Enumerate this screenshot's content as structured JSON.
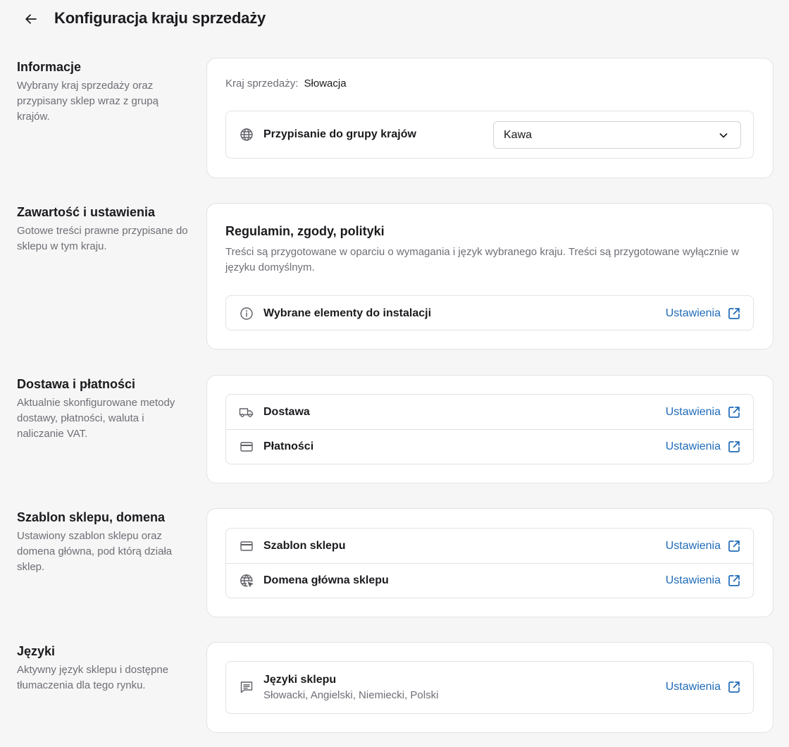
{
  "header": {
    "title": "Konfiguracja kraju sprzedaży"
  },
  "colors": {
    "link": "#1f6bb8",
    "muted": "#6e6e76",
    "border": "#e3e3e6"
  },
  "sections": {
    "info": {
      "title": "Informacje",
      "description": "Wybrany kraj sprzedaży oraz przypisany sklep wraz z grupą krajów.",
      "country_label": "Kraj sprzedaży:",
      "country_value": "Słowacja",
      "group_row": {
        "icon": "globe-icon",
        "label": "Przypisanie do grupy krajów",
        "selected": "Kawa"
      }
    },
    "content": {
      "title": "Zawartość i ustawienia",
      "description": "Gotowe treści prawne przypisane do sklepu w tym kraju.",
      "heading": "Regulamin, zgody, polityki",
      "text": "Treści są przygotowane w oparciu o wymagania i język wybranego kraju. Treści są przygotowane wyłącznie w języku domyślnym.",
      "row": {
        "icon": "info-icon",
        "label": "Wybrane elementy do instalacji",
        "link": "Ustawienia"
      }
    },
    "delivery": {
      "title": "Dostawa i płatności",
      "description": "Aktualnie skonfigurowane metody dostawy, płatności, waluta i naliczanie VAT.",
      "rows": [
        {
          "icon": "truck-icon",
          "label": "Dostawa",
          "link": "Ustawienia"
        },
        {
          "icon": "credit-card-icon",
          "label": "Płatności",
          "link": "Ustawienia"
        }
      ]
    },
    "template": {
      "title": "Szablon sklepu, domena",
      "description": "Ustawiony szablon sklepu oraz domena główna, pod którą działa sklep.",
      "rows": [
        {
          "icon": "template-icon",
          "label": "Szablon sklepu",
          "link": "Ustawienia"
        },
        {
          "icon": "globe-cursor-icon",
          "label": "Domena główna sklepu",
          "link": "Ustawienia"
        }
      ]
    },
    "languages": {
      "title": "Języki",
      "description": "Aktywny język sklepu i dostępne tłumaczenia dla tego rynku.",
      "row": {
        "icon": "message-lines-icon",
        "label": "Języki sklepu",
        "sub": "Słowacki, Angielski, Niemiecki, Polski",
        "link": "Ustawienia"
      }
    }
  }
}
